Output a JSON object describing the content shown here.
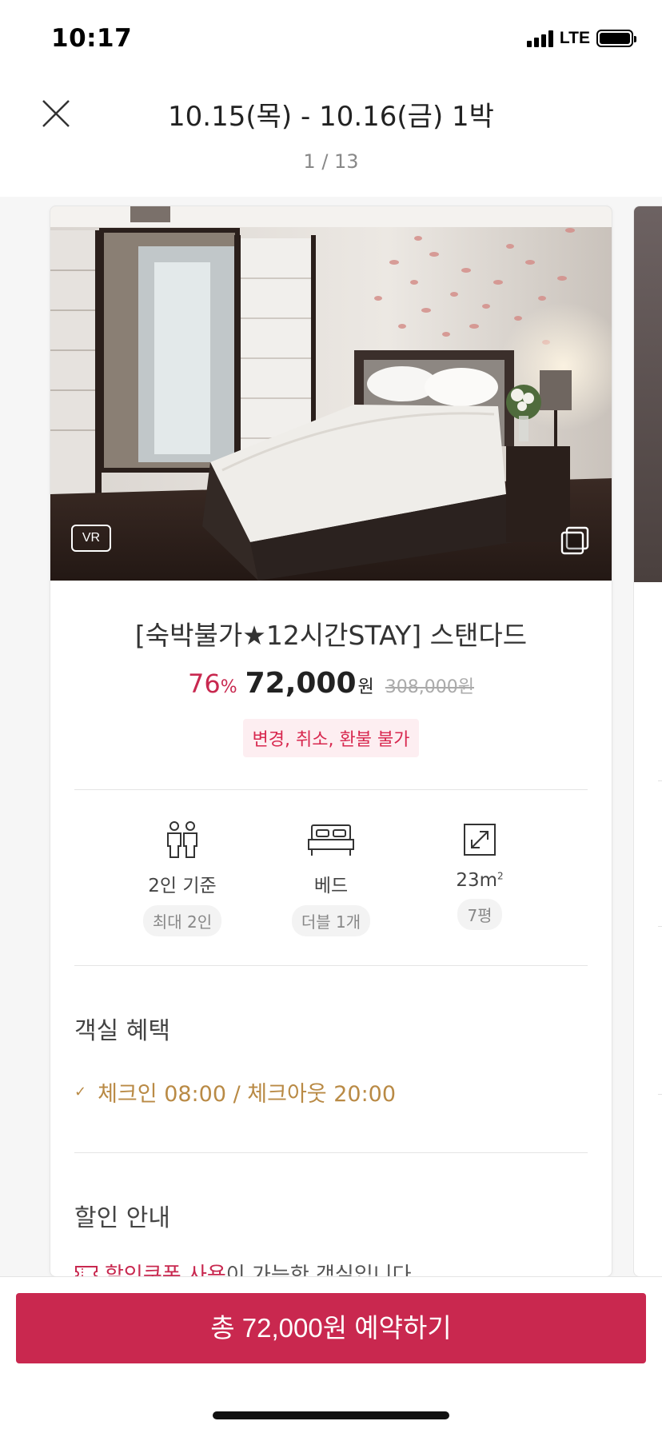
{
  "status_bar": {
    "time": "10:17",
    "network": "LTE"
  },
  "header": {
    "title": "10.15(목) - 10.16(금) 1박",
    "page_indicator": "1 / 13"
  },
  "room": {
    "photo_badge": "VR",
    "name": "[숙박불가★12시간STAY] 스탠다드",
    "discount_percent": "76",
    "discount_symbol": "%",
    "price": "72,000",
    "price_unit": "원",
    "original_price": "308,000원",
    "refund_policy": "변경, 취소, 환불 불가"
  },
  "specs": [
    {
      "icon": "people-icon",
      "label": "2인 기준",
      "sub": "최대 2인"
    },
    {
      "icon": "bed-icon",
      "label": "베드",
      "sub": "더블 1개"
    },
    {
      "icon": "expand-icon",
      "label": "23m",
      "label_sup": "2",
      "sub": "7평"
    }
  ],
  "benefits": {
    "title": "객실 혜택",
    "items": [
      "체크인 08:00 / 체크아웃 20:00"
    ]
  },
  "discount_info": {
    "title": "할인 안내",
    "coupon_highlight": "할인쿠폰 사용",
    "coupon_rest": "이 가능한 객실입니다."
  },
  "book_button": "총 72,000원 예약하기",
  "colors": {
    "accent": "#c9284f",
    "benefit": "#b98a45"
  }
}
